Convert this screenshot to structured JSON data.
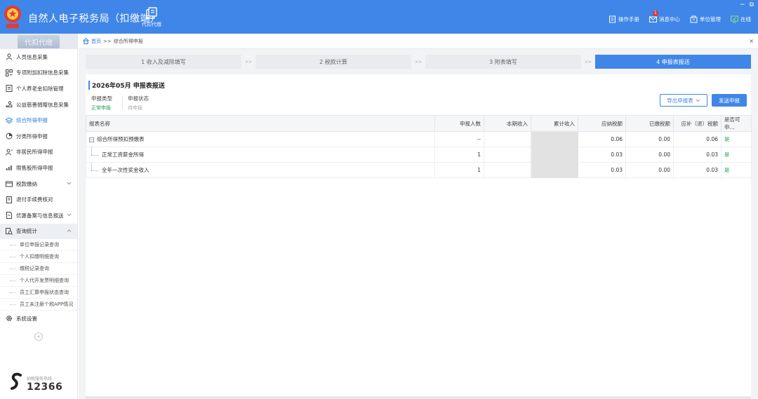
{
  "header": {
    "title": "自然人电子税务局（扣缴端）",
    "module_label": "代扣代缴",
    "actions": [
      {
        "label": "操作手册",
        "icon": "manual-icon"
      },
      {
        "label": "消息中心",
        "icon": "mail-icon",
        "badge": "1"
      },
      {
        "label": "单位管理",
        "icon": "building-icon"
      },
      {
        "label": "在线",
        "icon": "online-icon"
      }
    ],
    "window_controls": [
      "−",
      "⧉"
    ]
  },
  "sidebar": {
    "header": "代扣代缴",
    "items": [
      {
        "label": "人员信息采集",
        "icon": "person-icon"
      },
      {
        "label": "专项附加扣除信息采集",
        "icon": "grid-icon"
      },
      {
        "label": "个人养老金扣除管理",
        "icon": "document-icon"
      },
      {
        "label": "公益慈善捐赠信息采集",
        "icon": "donation-icon"
      },
      {
        "label": "综合所得申报",
        "icon": "layers-icon",
        "active": true
      },
      {
        "label": "分类所得申报",
        "icon": "pie-icon"
      },
      {
        "label": "非居民所得申报",
        "icon": "user-icon"
      },
      {
        "label": "限售股所得申报",
        "icon": "bar-chart-icon"
      },
      {
        "label": "税款缴纳",
        "icon": "wallet-icon",
        "expandable": true
      },
      {
        "label": "退付手续费核对",
        "icon": "receipt-icon"
      },
      {
        "label": "优惠备案与信息报送",
        "icon": "file-icon",
        "expandable": true
      },
      {
        "label": "查询统计",
        "icon": "search-doc-icon",
        "expanded": true
      }
    ],
    "sub_items": [
      "单位申报记录查询",
      "个人扣缴明细查询",
      "缴税记录查询",
      "个人代开发票明细查询",
      "员工汇算申报状态查询",
      "员工未注册个税APP情况"
    ],
    "settings": {
      "label": "系统设置",
      "icon": "gear-icon"
    },
    "collapse_glyph": "«",
    "hotline": {
      "label": "纳税服务热线",
      "number": "12366"
    }
  },
  "breadcrumb": {
    "home": "首页",
    "separator": ">>",
    "current": "综合所得申报",
    "close": "×"
  },
  "steps": [
    {
      "label": "1 收入及减除填写"
    },
    {
      "label": "2 税款计算"
    },
    {
      "label": "3 附表填写"
    },
    {
      "label": "4 申报表报送",
      "active": true
    }
  ],
  "step_separator": ">>",
  "panel": {
    "title": "2026年05月  申报表报送",
    "declare_type_label": "申报类型",
    "declare_type_value": "正常申报",
    "declare_status_label": "申报状态",
    "declare_status_value": "待申报",
    "export_button": "导出申报表",
    "send_button": "发送申报"
  },
  "table": {
    "headers": [
      "报表名称",
      "申报人数",
      "本期收入",
      "累计收入",
      "应纳税额",
      "已缴税额",
      "应补（退）税额",
      "是否可申..."
    ],
    "rows": [
      {
        "name": "综合所得预扣预缴表",
        "count": "--",
        "income": "",
        "cumulative": "",
        "payable": "0.06",
        "paid": "0.00",
        "refund": "0.06",
        "ok": "是",
        "parent": true,
        "tree_toggle": "−"
      },
      {
        "name": "正常工资薪金所得",
        "count": "1",
        "income": "",
        "cumulative": "",
        "payable": "0.03",
        "paid": "0.00",
        "refund": "0.03",
        "ok": "是"
      },
      {
        "name": "全年一次性奖金收入",
        "count": "1",
        "income": "",
        "cumulative": "",
        "payable": "0.03",
        "paid": "0.00",
        "refund": "0.03",
        "ok": "是"
      }
    ]
  },
  "colors": {
    "accent": "#3f86e8",
    "success": "#2a9d56",
    "header_bg": "#3f86e8"
  }
}
